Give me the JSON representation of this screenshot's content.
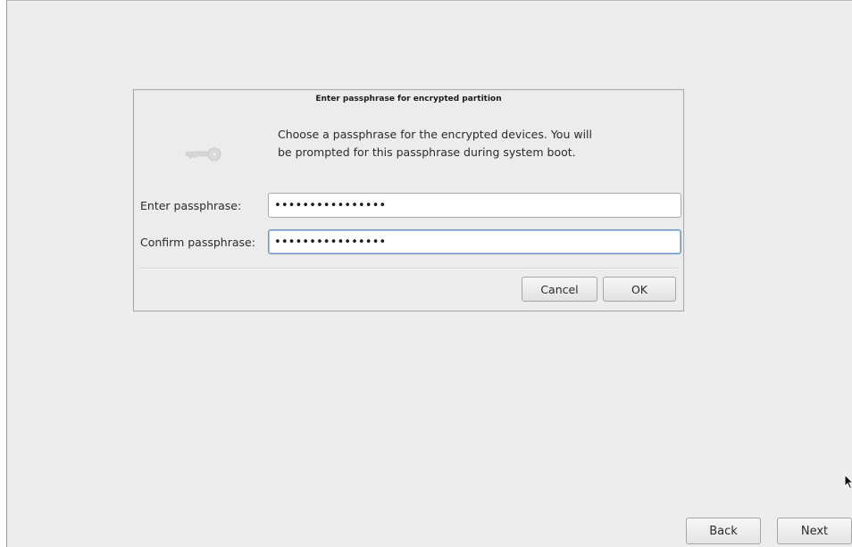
{
  "dialog": {
    "title": "Enter passphrase for encrypted partition",
    "message": "Choose a passphrase for the encrypted devices. You will be prompted for this passphrase during system boot.",
    "icon": "key-icon",
    "fields": [
      {
        "label": "Enter passphrase:",
        "value": "••••••••••••••••"
      },
      {
        "label": "Confirm passphrase:",
        "value": "••••••••••••••••"
      }
    ],
    "cancel_label": "Cancel",
    "ok_label": "OK"
  },
  "navigation": {
    "back_label": "Back",
    "next_label": "Next"
  },
  "colors": {
    "background": "#ededed",
    "focus_border": "#6d95c3"
  }
}
